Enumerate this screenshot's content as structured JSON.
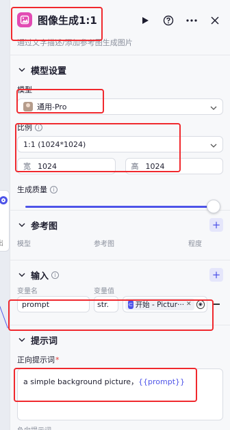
{
  "canvas": {
    "node_text": "出"
  },
  "header": {
    "title": "图像生成1:1",
    "description": "通过文字描述/添加参考图生成图片",
    "icon_color": "#e24bb3"
  },
  "model_settings": {
    "section_title": "模型设置",
    "model_label": "模型",
    "model_value": "通用-Pro",
    "ratio_label": "比例",
    "ratio_value": "1:1 (1024*1024)",
    "width_prefix": "宽",
    "width_value": "1024",
    "height_prefix": "高",
    "height_value": "1024",
    "quality_label": "生成质量",
    "quality_level": 1.0
  },
  "reference": {
    "section_title": "参考图",
    "columns": [
      "模型",
      "参考图",
      "程度"
    ]
  },
  "input": {
    "section_title": "输入",
    "columns": [
      "变量名",
      "变量值"
    ],
    "rows": [
      {
        "name": "prompt",
        "type": "str.",
        "ref_label": "开始 - Pictur···",
        "ref_icon_text": "⊂"
      }
    ]
  },
  "prompt": {
    "section_title": "提示词",
    "positive_label": "正向提示词",
    "required_mark": "*",
    "text_plain": "a simple background picture，",
    "text_var": "{{prompt}}",
    "cut_label": "负向提示词"
  },
  "colors": {
    "accent": "#4d53e8",
    "highlight": "#f0282d"
  }
}
